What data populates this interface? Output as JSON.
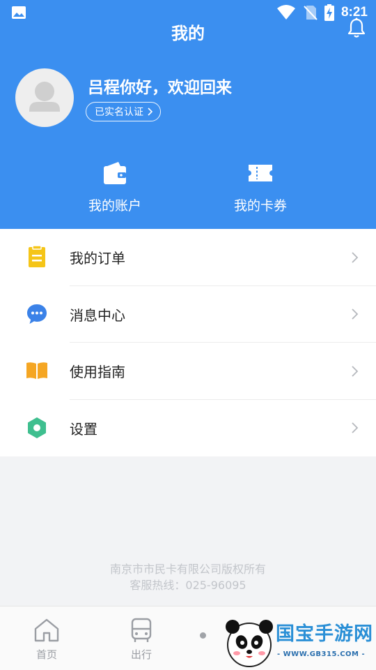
{
  "status_bar": {
    "time": "8:21"
  },
  "header": {
    "title": "我的"
  },
  "profile": {
    "greeting": "吕程你好，欢迎回来",
    "verify_label": "已实名认证"
  },
  "quick_actions": [
    {
      "label": "我的账户",
      "icon": "wallet-icon"
    },
    {
      "label": "我的卡券",
      "icon": "ticket-icon"
    }
  ],
  "menu": [
    {
      "label": "我的订单",
      "icon": "order-clipboard-icon",
      "color": "#f5c518"
    },
    {
      "label": "消息中心",
      "icon": "message-bubble-icon",
      "color": "#3b82e8"
    },
    {
      "label": "使用指南",
      "icon": "book-icon",
      "color": "#f5a623"
    },
    {
      "label": "设置",
      "icon": "settings-hexagon-icon",
      "color": "#3fbf8f"
    }
  ],
  "footer": {
    "copyright": "南京市市民卡有限公司版权所有",
    "hotline": "客服热线：025-96095"
  },
  "tabbar": {
    "tabs": [
      {
        "label": "首页"
      },
      {
        "label": "出行"
      }
    ]
  },
  "watermark": {
    "text": "国宝手游网",
    "url": "- WWW.GB315.COM -"
  },
  "colors": {
    "brand_blue": "#3b8ff0"
  }
}
